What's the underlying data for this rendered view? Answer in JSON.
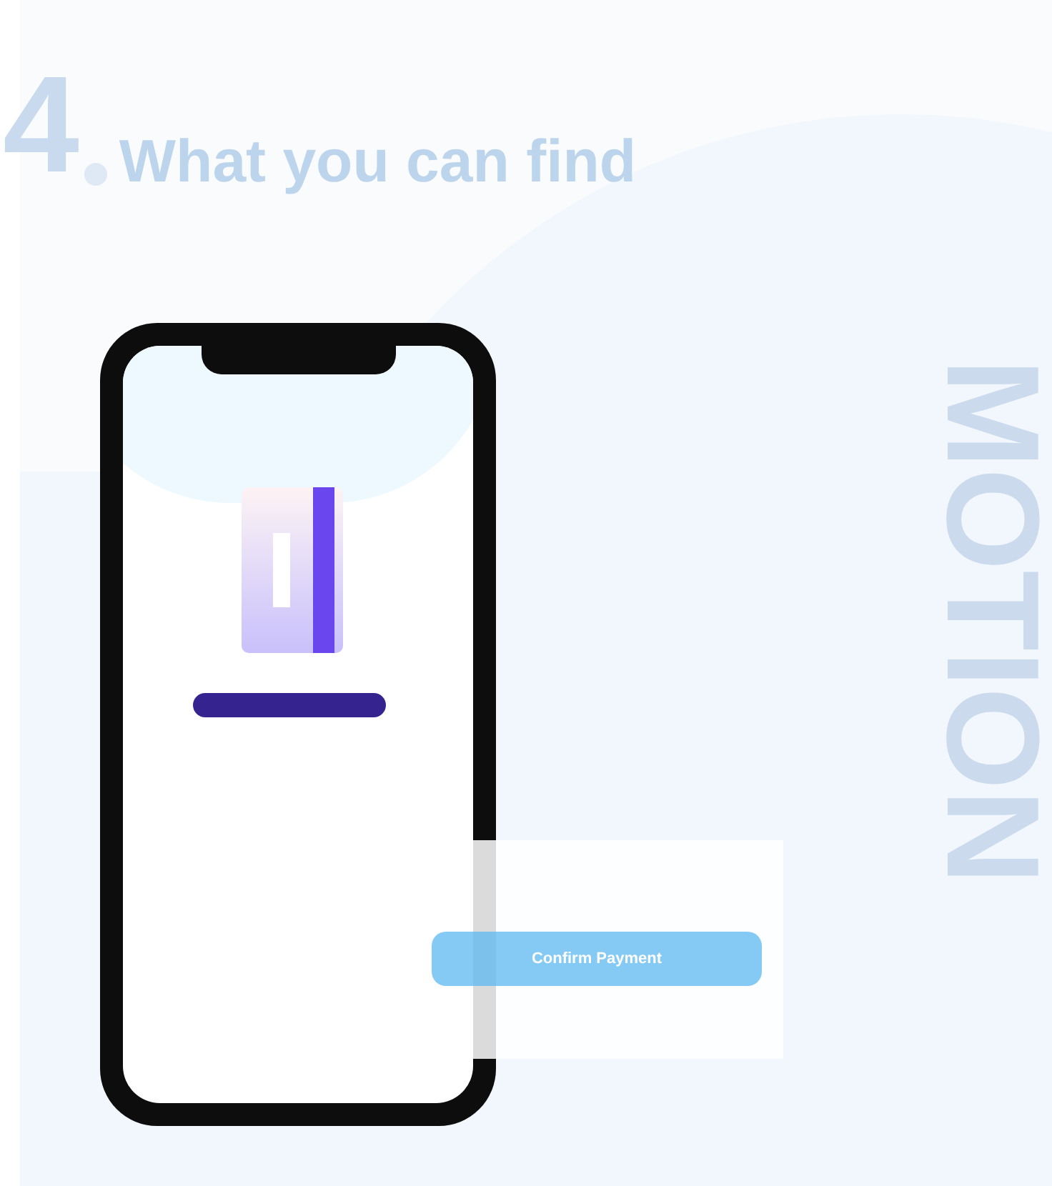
{
  "section": {
    "number": "4",
    "title": "What you can find"
  },
  "side_word": "MOTION",
  "payment_panel": {
    "button": "Confirm Payment"
  }
}
